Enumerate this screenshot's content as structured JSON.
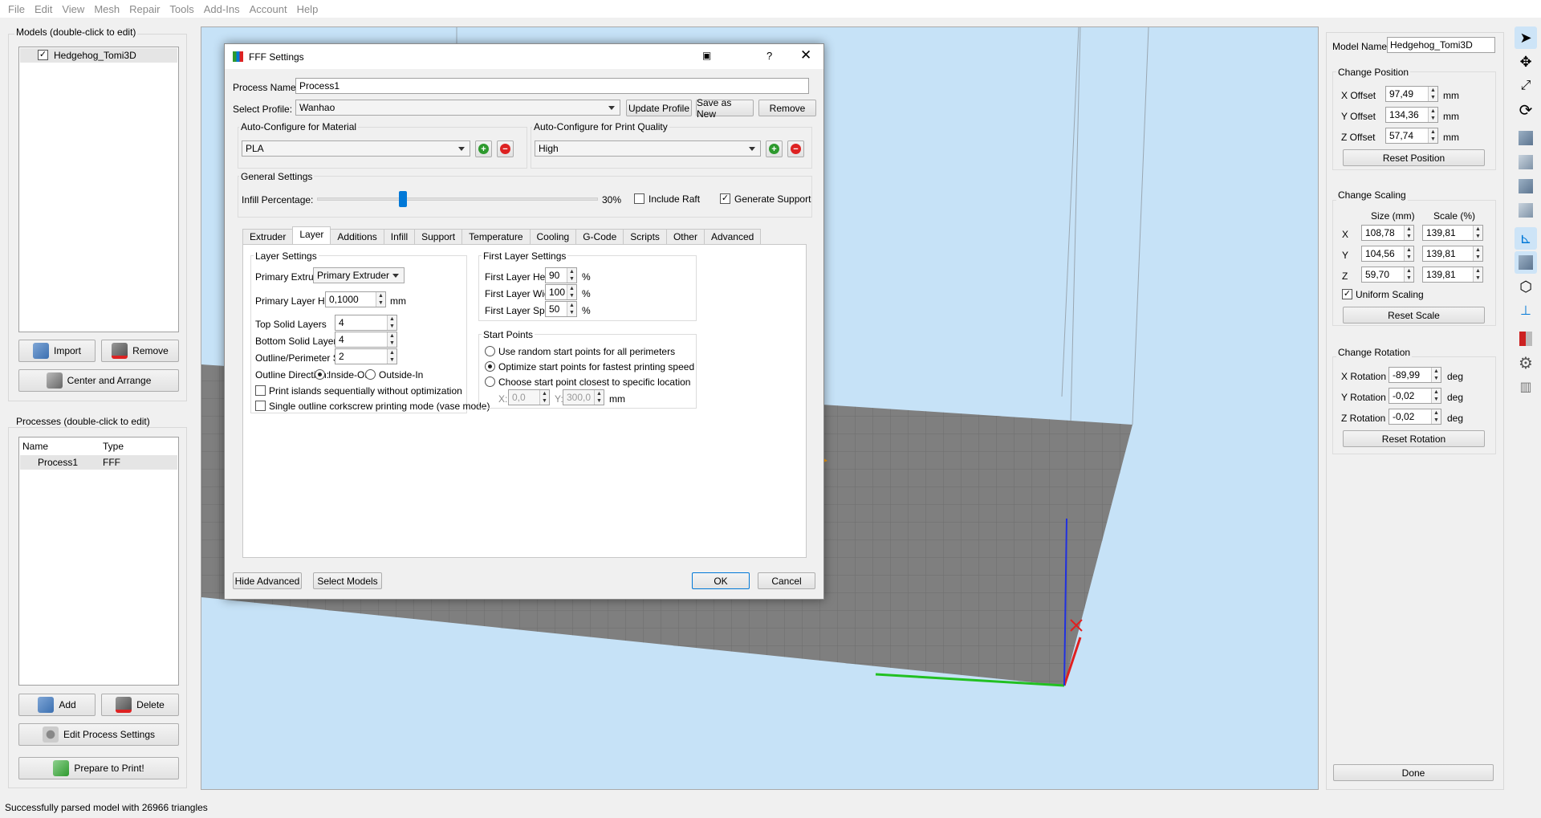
{
  "menu": [
    "File",
    "Edit",
    "View",
    "Mesh",
    "Repair",
    "Tools",
    "Add-Ins",
    "Account",
    "Help"
  ],
  "models_panel": {
    "title": "Models (double-click to edit)",
    "items": [
      {
        "name": "Hedgehog_Tomi3D",
        "checked": true
      }
    ],
    "import_label": "Import",
    "remove_label": "Remove",
    "center_label": "Center and Arrange"
  },
  "processes_panel": {
    "title": "Processes (double-click to edit)",
    "columns": [
      "Name",
      "Type"
    ],
    "rows": [
      {
        "name": "Process1",
        "type": "FFF"
      }
    ],
    "add_label": "Add",
    "delete_label": "Delete",
    "edit_label": "Edit Process Settings",
    "prepare_label": "Prepare to Print!"
  },
  "dialog": {
    "title": "FFF Settings",
    "process_name_label": "Process Name:",
    "process_name": "Process1",
    "select_profile_label": "Select Profile:",
    "profile": "Wanhao",
    "update_profile": "Update Profile",
    "save_as_new": "Save as New",
    "remove": "Remove",
    "auto_material_label": "Auto-Configure for Material",
    "material": "PLA",
    "auto_quality_label": "Auto-Configure for Print Quality",
    "quality": "High",
    "general_label": "General Settings",
    "infill_label": "Infill Percentage:",
    "infill_value": "30%",
    "infill_fraction": 0.3,
    "include_raft": "Include Raft",
    "include_raft_checked": false,
    "generate_support": "Generate Support",
    "generate_support_checked": true,
    "tabs": [
      "Extruder",
      "Layer",
      "Additions",
      "Infill",
      "Support",
      "Temperature",
      "Cooling",
      "G-Code",
      "Scripts",
      "Other",
      "Advanced"
    ],
    "active_tab": "Layer",
    "layer": {
      "group_title": "Layer Settings",
      "primary_extruder_label": "Primary Extruder",
      "primary_extruder": "Primary Extruder",
      "primary_layer_height_label": "Primary Layer Height",
      "primary_layer_height": "0,1000",
      "mm": "mm",
      "top_solid_label": "Top Solid Layers",
      "top_solid": "4",
      "bottom_solid_label": "Bottom Solid Layers",
      "bottom_solid": "4",
      "outline_shells_label": "Outline/Perimeter Shells",
      "outline_shells": "2",
      "outline_direction_label": "Outline Direction:",
      "inside_out": "Inside-Out",
      "outside_in": "Outside-In",
      "print_islands": "Print islands sequentially without optimization",
      "vase_mode": "Single outline corkscrew printing mode (vase mode)"
    },
    "first_layer": {
      "group_title": "First Layer Settings",
      "height_label": "First Layer Height",
      "height": "90",
      "width_label": "First Layer Width",
      "width": "100",
      "speed_label": "First Layer Speed",
      "speed": "50",
      "pct": "%"
    },
    "start_points": {
      "group_title": "Start Points",
      "opt1": "Use random start points for all perimeters",
      "opt2": "Optimize start points for fastest printing speed",
      "opt3": "Choose start point closest to specific location",
      "x_label": "X:",
      "x": "0,0",
      "y_label": "Y:",
      "y": "300,0",
      "mm": "mm"
    },
    "hide_advanced": "Hide Advanced",
    "select_models": "Select Models",
    "ok": "OK",
    "cancel": "Cancel"
  },
  "right_panel": {
    "model_name_label": "Model Name:",
    "model_name": "Hedgehog_Tomi3D",
    "position_title": "Change Position",
    "x_offset_label": "X Offset",
    "x_offset": "97,49",
    "y_offset_label": "Y Offset",
    "y_offset": "134,36",
    "z_offset_label": "Z Offset",
    "z_offset": "57,74",
    "mm": "mm",
    "reset_position": "Reset Position",
    "scaling_title": "Change Scaling",
    "size_label": "Size (mm)",
    "scale_label": "Scale (%)",
    "x_label": "X",
    "y_label": "Y",
    "z_label": "Z",
    "size_x": "108,78",
    "size_y": "104,56",
    "size_z": "59,70",
    "scale_x": "139,81",
    "scale_y": "139,81",
    "scale_z": "139,81",
    "uniform_scaling": "Uniform Scaling",
    "reset_scale": "Reset Scale",
    "rotation_title": "Change Rotation",
    "x_rot_label": "X Rotation",
    "x_rot": "-89,99",
    "y_rot_label": "Y Rotation",
    "y_rot": "-0,02",
    "z_rot_label": "Z Rotation",
    "z_rot": "-0,02",
    "deg": "deg",
    "reset_rotation": "Reset Rotation",
    "done": "Done"
  },
  "status": "Successfully parsed model with 26966 triangles",
  "colors": {
    "accent": "#0078d7",
    "model": "#f7a21b",
    "model_dark": "#e25c00",
    "bed": "#808080",
    "sky": "#c6e2f7"
  }
}
